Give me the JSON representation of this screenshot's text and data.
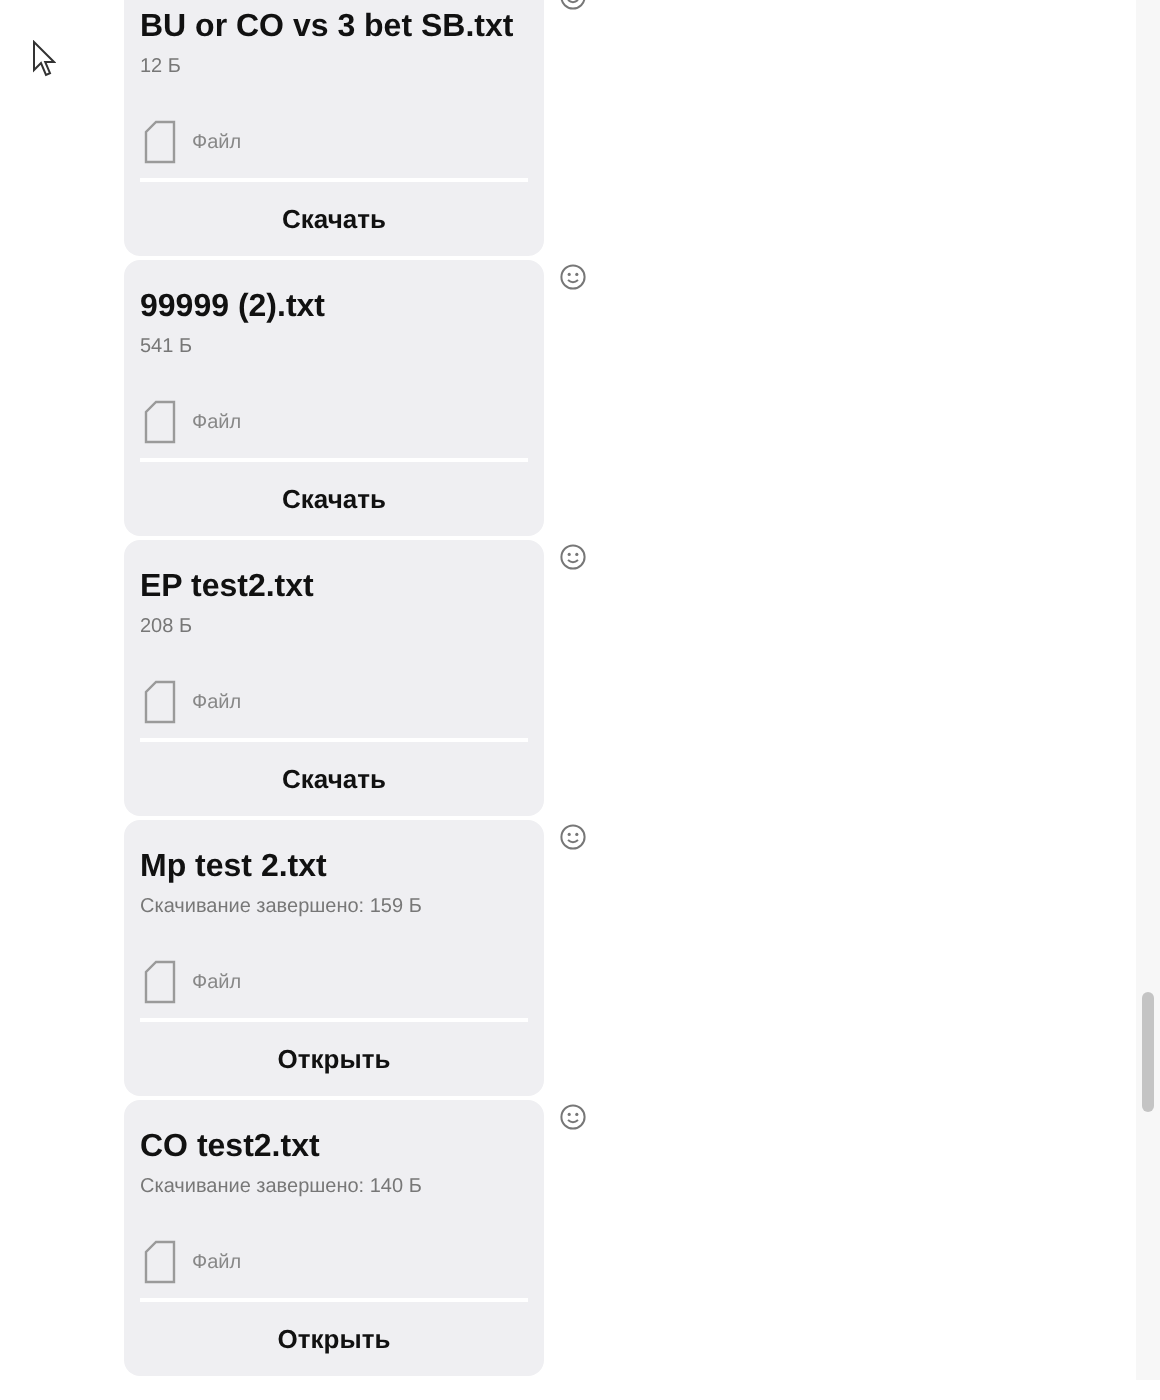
{
  "messages": [
    {
      "file_name": "BU or CO vs 3 bet SB.txt",
      "status": "12 Б",
      "file_type": "Файл",
      "action": "Скачать"
    },
    {
      "file_name": "99999 (2).txt",
      "status": "541 Б",
      "file_type": "Файл",
      "action": "Скачать"
    },
    {
      "file_name": "EP test2.txt",
      "status": "208 Б",
      "file_type": "Файл",
      "action": "Скачать"
    },
    {
      "file_name": "Mp test 2.txt",
      "status": "Скачивание завершено: 159 Б",
      "file_type": "Файл",
      "action": "Открыть"
    },
    {
      "file_name": "CO test2.txt",
      "status": "Скачивание завершено: 140 Б",
      "file_type": "Файл",
      "action": "Открыть"
    }
  ]
}
